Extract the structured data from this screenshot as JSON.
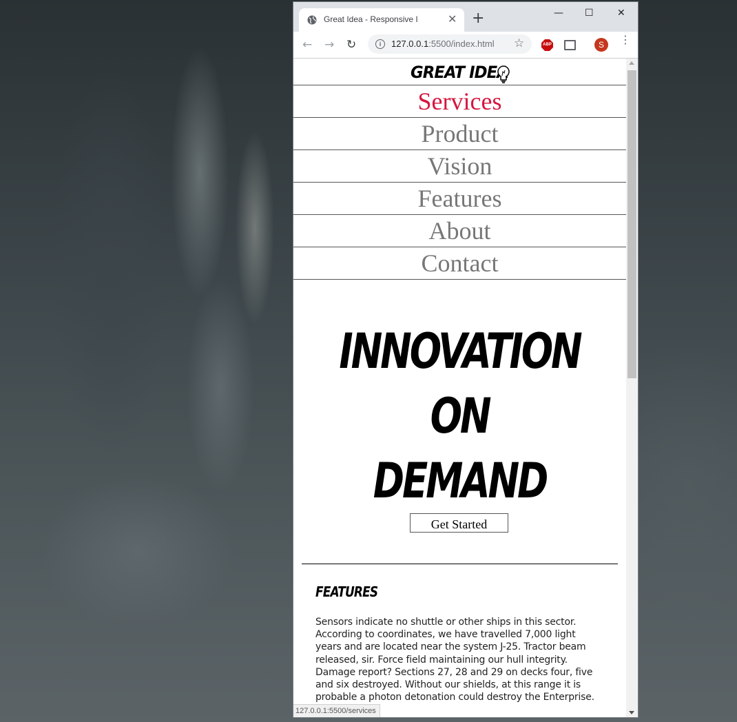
{
  "browser": {
    "tab_title": "Great Idea - Responsive I",
    "tab_close": "✕",
    "new_tab": "+",
    "controls": {
      "minimize": "—",
      "maximize": "☐",
      "close": "✕"
    },
    "nav_icons": {
      "back": "←",
      "forward": "→",
      "reload": "↻"
    },
    "url_host": "127.0.0.1",
    "url_rest": ":5500/index.html",
    "bookmark_star": "☆",
    "abp_label": "ABP",
    "profile_initial": "S",
    "menu": "⋮",
    "status_url": "127.0.0.1:5500/services"
  },
  "page": {
    "logo": "GREAT IDEA",
    "nav": [
      "Services",
      "Product",
      "Vision",
      "Features",
      "About",
      "Contact"
    ],
    "active_nav": "Services",
    "accent_color": "#d6163f",
    "hero": [
      "INNOVATION",
      "ON",
      "DEMAND"
    ],
    "cta_label": "Get Started",
    "features_title": "FEATURES",
    "features_text": "Sensors indicate no shuttle or other ships in this sector. According to coordinates, we have travelled 7,000 light years and are located near the system J-25. Tractor beam released, sir. Force field maintaining our hull integrity. Damage report? Sections 27, 28 and 29 on decks four, five and six destroyed. Without our shields, at this range it is probable a photon detonation could destroy the Enterprise."
  }
}
